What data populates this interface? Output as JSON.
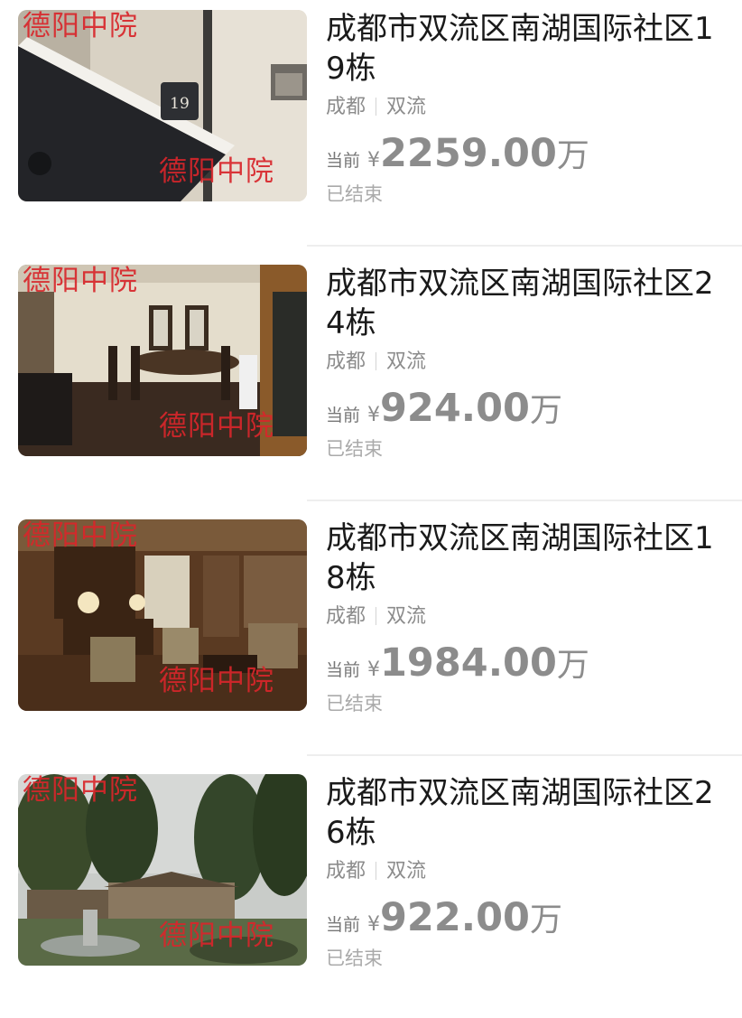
{
  "listings": [
    {
      "title": "成都市双流区南湖国际社区19栋",
      "city": "成都",
      "district": "双流",
      "price_label": "当前",
      "currency": "¥",
      "price": "2259.00",
      "unit": "万",
      "status": "已结束",
      "watermark": "德阳中院"
    },
    {
      "title": "成都市双流区南湖国际社区24栋",
      "city": "成都",
      "district": "双流",
      "price_label": "当前",
      "currency": "¥",
      "price": "924.00",
      "unit": "万",
      "status": "已结束",
      "watermark": "德阳中院"
    },
    {
      "title": "成都市双流区南湖国际社区18栋",
      "city": "成都",
      "district": "双流",
      "price_label": "当前",
      "currency": "¥",
      "price": "1984.00",
      "unit": "万",
      "status": "已结束",
      "watermark": "德阳中院"
    },
    {
      "title": "成都市双流区南湖国际社区26栋",
      "city": "成都",
      "district": "双流",
      "price_label": "当前",
      "currency": "¥",
      "price": "922.00",
      "unit": "万",
      "status": "已结束",
      "watermark": "德阳中院"
    }
  ],
  "house_number_sign": "19",
  "colors": {
    "watermark": "#d8262b",
    "title": "#1a1a1a",
    "muted": "#8c8c8c",
    "divider": "#eeeeee"
  }
}
